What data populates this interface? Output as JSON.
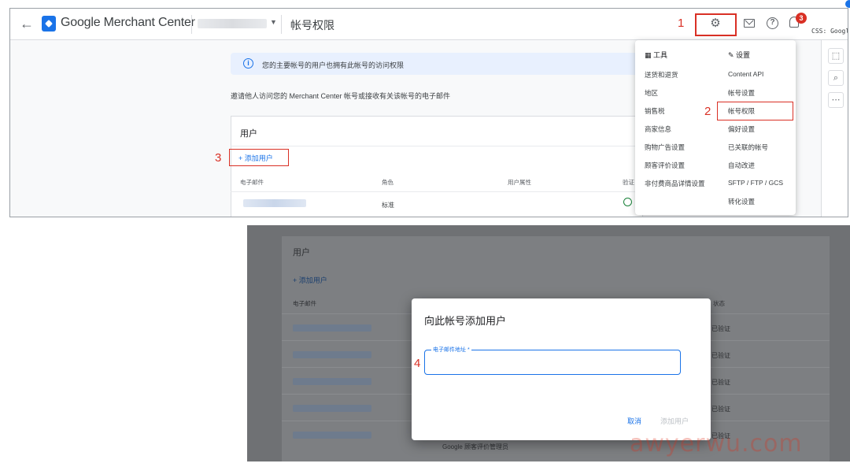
{
  "header": {
    "brand": "Google Merchant Center",
    "page_title": "帐号权限",
    "notification_count": "3",
    "css_label": "CSS: Googl"
  },
  "steps": {
    "s1": "1",
    "s2": "2",
    "s3": "3",
    "s4": "4"
  },
  "content": {
    "info_banner": "您的主要帐号的用户也拥有此帐号的访问权限",
    "invite_text": "邀请他人访问您的 Merchant Center 帐号或接收有关该帐号的电子邮件",
    "users_title": "用户",
    "add_user": "+ 添加用户",
    "columns": {
      "email": "电子邮件",
      "role": "角色",
      "attr": "用户属性",
      "verify": "验证"
    },
    "row_role": "标准"
  },
  "settings_menu": {
    "tools_head": "▦ 工具",
    "settings_head": "✎ 设置",
    "tools": [
      "送货和退货",
      "地区",
      "销售税",
      "商家信息",
      "购物广告设置",
      "顾客评价设置",
      "非付费商品详情设置"
    ],
    "settings": [
      "Content API",
      "帐号设置",
      "帐号权限",
      "偏好设置",
      "已关联的帐号",
      "自动改进",
      "SFTP / FTP / GCS",
      "转化设置"
    ]
  },
  "bottom": {
    "users_title": "用户",
    "add_user": "+ 添加用户",
    "th_email": "电子邮件",
    "th_status": "状态",
    "status": [
      "已验证",
      "已验证",
      "已验证",
      "已验证",
      "已验证"
    ],
    "role_text": "Google 顾客评价管理员"
  },
  "dialog": {
    "title": "向此帐号添加用户",
    "email_label": "电子邮件地址 *",
    "cancel": "取消",
    "add": "添加用户"
  },
  "watermark": "awyerwu.com"
}
